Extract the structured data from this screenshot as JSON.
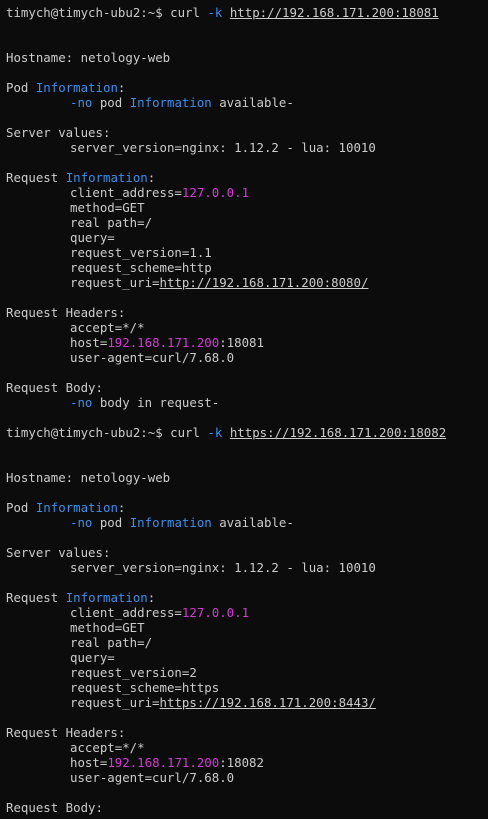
{
  "blocks": [
    {
      "prompt": "timych@timych-ubu2:~$ ",
      "cmd": "curl",
      "flag": "-k",
      "url": "http://192.168.171.200:18081",
      "hostname_label": "Hostname: ",
      "hostname": "netology-web",
      "pod_word": "Pod ",
      "info_word": "Information",
      "colon": ":",
      "no_prefix": "-no",
      "no_pod_mid": " pod ",
      "no_pod_end": " available-",
      "server_values_label": "Server values:",
      "server_version": "server_version=nginx: 1.12.2 - lua: 10010",
      "request_word": "Request ",
      "client_address_key": "client_address=",
      "client_address": "127.0.0.1",
      "method": "method=GET",
      "real_path": "real path=/",
      "query": "query=",
      "request_version": "request_version=1.1",
      "request_scheme": "request_scheme=http",
      "request_uri_key": "request_uri=",
      "request_uri": "http://192.168.171.200:8080/",
      "headers_label": "Request Headers:",
      "accept": "accept=*/*",
      "host_key": "host=",
      "host_ip": "192.168.171.200",
      "host_port": ":18081",
      "user_agent": "user-agent=curl/7.68.0",
      "body_label": "Request Body:",
      "no_body_end": " body in request-"
    },
    {
      "prompt": "timych@timych-ubu2:~$ ",
      "cmd": "curl",
      "flag": "-k",
      "url": "https://192.168.171.200:18082",
      "hostname_label": "Hostname: ",
      "hostname": "netology-web",
      "pod_word": "Pod ",
      "info_word": "Information",
      "colon": ":",
      "no_prefix": "-no",
      "no_pod_mid": " pod ",
      "no_pod_end": " available-",
      "server_values_label": "Server values:",
      "server_version": "server_version=nginx: 1.12.2 - lua: 10010",
      "request_word": "Request ",
      "client_address_key": "client_address=",
      "client_address": "127.0.0.1",
      "method": "method=GET",
      "real_path": "real path=/",
      "query": "query=",
      "request_version": "request_version=2",
      "request_scheme": "request_scheme=https",
      "request_uri_key": "request_uri=",
      "request_uri": "https://192.168.171.200:8443/",
      "headers_label": "Request Headers:",
      "accept": "accept=*/*",
      "host_key": "host=",
      "host_ip": "192.168.171.200",
      "host_port": ":18082",
      "user_agent": "user-agent=curl/7.68.0",
      "body_label": "Request Body:"
    }
  ],
  "colors": {
    "background": "#0c0c0c",
    "text": "#cccccc",
    "keyword_blue": "#3b8eea",
    "ip_magenta": "#d33ad3"
  }
}
